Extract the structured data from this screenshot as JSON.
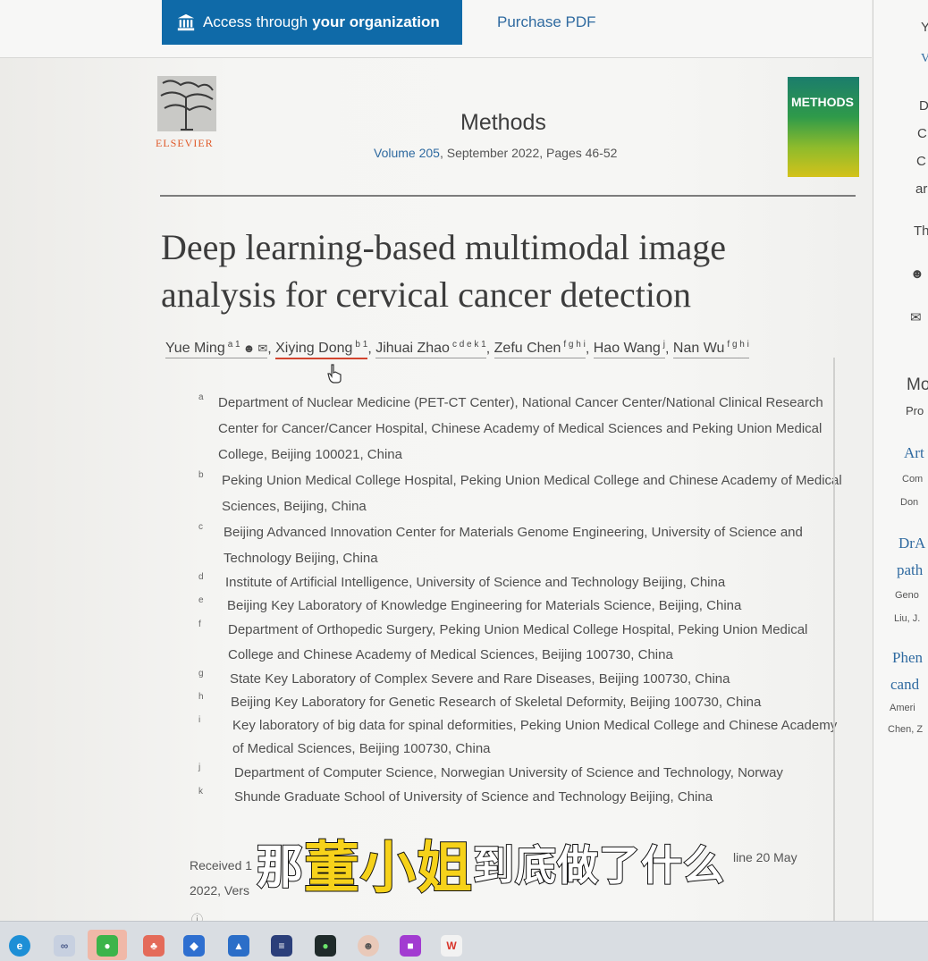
{
  "topbar": {
    "access_prefix": "Access through",
    "access_org": "your organization",
    "purchase": "Purchase PDF"
  },
  "journal": {
    "publisher": "ELSEVIER",
    "name": "Methods",
    "volume_link": "Volume 205",
    "issue_info": ", September 2022, Pages 46-52",
    "cover_text": "METHODS"
  },
  "article": {
    "title": "Deep learning-based multimodal image analysis for cervical cancer detection",
    "authors": [
      {
        "name": "Yue Ming",
        "sup": "a 1"
      },
      {
        "name": "Xiying Dong",
        "sup": "b 1"
      },
      {
        "name": "Jihuai Zhao",
        "sup": "c d e k 1"
      },
      {
        "name": "Zefu Chen",
        "sup": "f g h i"
      },
      {
        "name": "Hao Wang",
        "sup": "j"
      },
      {
        "name": "Nan Wu",
        "sup": "f g h i"
      }
    ],
    "separator": ",",
    "affiliations": [
      {
        "letter": "a",
        "text": "Department of Nuclear Medicine (PET-CT Center), National Cancer Center/National Clinical Research Center for Cancer/Cancer Hospital, Chinese Academy of Medical Sciences and Peking Union Medical College, Beijing 100021, China"
      },
      {
        "letter": "b",
        "text": "Peking Union Medical College Hospital, Peking Union Medical College and Chinese Academy of Medical Sciences, Beijing, China"
      },
      {
        "letter": "c",
        "text": "Beijing Advanced Innovation Center for Materials Genome Engineering, University of Science and Technology Beijing, China"
      },
      {
        "letter": "d",
        "text": "Institute of Artificial Intelligence, University of Science and Technology Beijing, China"
      },
      {
        "letter": "e",
        "text": "Beijing Key Laboratory of Knowledge Engineering for Materials Science, Beijing, China"
      },
      {
        "letter": "f",
        "text": "Department of Orthopedic Surgery, Peking Union Medical College Hospital, Peking Union Medical College and Chinese Academy of Medical Sciences, Beijing 100730, China"
      },
      {
        "letter": "g",
        "text": "State Key Laboratory of Complex Severe and Rare Diseases, Beijing 100730, China"
      },
      {
        "letter": "h",
        "text": "Beijing Key Laboratory for Genetic Research of Skeletal Deformity, Beijing 100730, China"
      },
      {
        "letter": "i",
        "text": "Key laboratory of big data for spinal deformities, Peking Union Medical College and Chinese Academy of Medical Sciences, Beijing 100730, China"
      },
      {
        "letter": "j",
        "text": "Department of Computer Science, Norwegian University of Science and Technology, Norway"
      },
      {
        "letter": "k",
        "text": "Shunde Graduate School of University of Science and Technology Beijing, China"
      }
    ],
    "received_start": "Received 1",
    "received_line2": "2022, Vers",
    "online": "line 20 May"
  },
  "right_panel": {
    "items": [
      "Y",
      "V",
      "D",
      "C",
      "C",
      "ar",
      "Th",
      "Mo",
      "Pro",
      "Art",
      "Com",
      "Don",
      "DrA",
      "path",
      "Geno",
      "Liu, J.",
      "Phen",
      "cand",
      "Ameri",
      "Chen, Z"
    ]
  },
  "subtitle": {
    "part1": "那",
    "highlight": "董小姐",
    "part2": "到底做了什么"
  },
  "taskbar": {
    "icons": [
      "edge-icon",
      "copilot-icon",
      "wechat-icon",
      "game-icon",
      "security-icon",
      "photos-icon",
      "app-icon",
      "green-app-icon",
      "avatar-app-icon",
      "purple-app-icon",
      "wps-icon"
    ],
    "colors": {
      "accent": "#0f6aa8",
      "subtitle_yellow": "#f6d21a"
    }
  }
}
